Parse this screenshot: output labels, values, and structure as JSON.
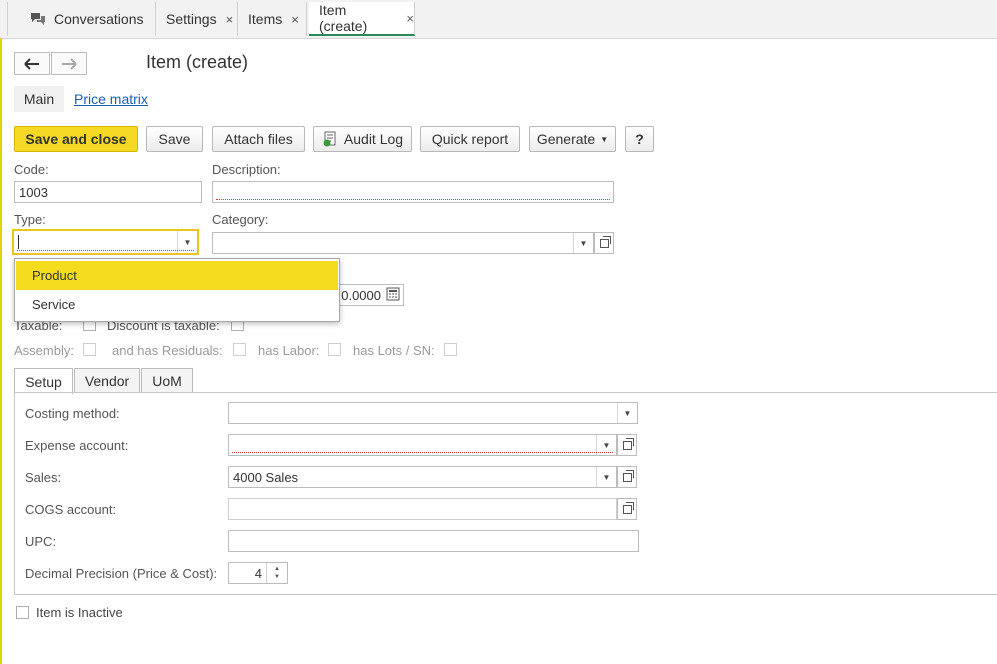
{
  "tabs": [
    {
      "label": "Conversations",
      "closable": false
    },
    {
      "label": "Settings",
      "closable": true
    },
    {
      "label": "Items",
      "closable": true
    },
    {
      "label": "Item (create)",
      "closable": true,
      "active": true
    }
  ],
  "close_glyph": "×",
  "nav": {
    "back_icon": "arrow-left-icon",
    "forward_icon": "arrow-right-icon"
  },
  "page_title": "Item (create)",
  "subtabs": {
    "main": "Main",
    "price_matrix": "Price matrix"
  },
  "toolbar": {
    "save_and_close": "Save and close",
    "save": "Save",
    "attach_files": "Attach files",
    "audit_log": "Audit Log",
    "quick_report": "Quick report",
    "generate": "Generate",
    "help": "?"
  },
  "form": {
    "code_label": "Code:",
    "code_value": "1003",
    "description_label": "Description:",
    "description_value": "",
    "type_label": "Type:",
    "type_value": "",
    "category_label": "Category:",
    "category_value": "",
    "hidden_value_fragment": "0.0000",
    "taxable_label": "Taxable:",
    "discount_taxable_label": "Discount is taxable:",
    "assembly_label": "Assembly:",
    "has_residuals_label": "and has Residuals:",
    "has_labor_label": "has Labor:",
    "has_lots_label": "has Lots / SN:"
  },
  "type_dropdown": {
    "options": [
      "Product",
      "Service"
    ],
    "highlighted": "Product"
  },
  "inner_tabs": {
    "setup": "Setup",
    "vendor": "Vendor",
    "uom": "UoM"
  },
  "setup": {
    "costing_method_label": "Costing method:",
    "costing_method_value": "",
    "expense_account_label": "Expense account:",
    "expense_account_value": "",
    "sales_label": "Sales:",
    "sales_value": "4000 Sales",
    "cogs_account_label": "COGS account:",
    "cogs_account_value": "",
    "upc_label": "UPC:",
    "upc_value": "",
    "decimal_precision_label": "Decimal Precision (Price & Cost):",
    "decimal_precision_value": "4"
  },
  "inactive_label": "Item is Inactive",
  "colors": {
    "accent_yellow": "#f6d924",
    "active_tab_underline": "#2a8a5a",
    "link_blue": "#1a5fb4"
  }
}
